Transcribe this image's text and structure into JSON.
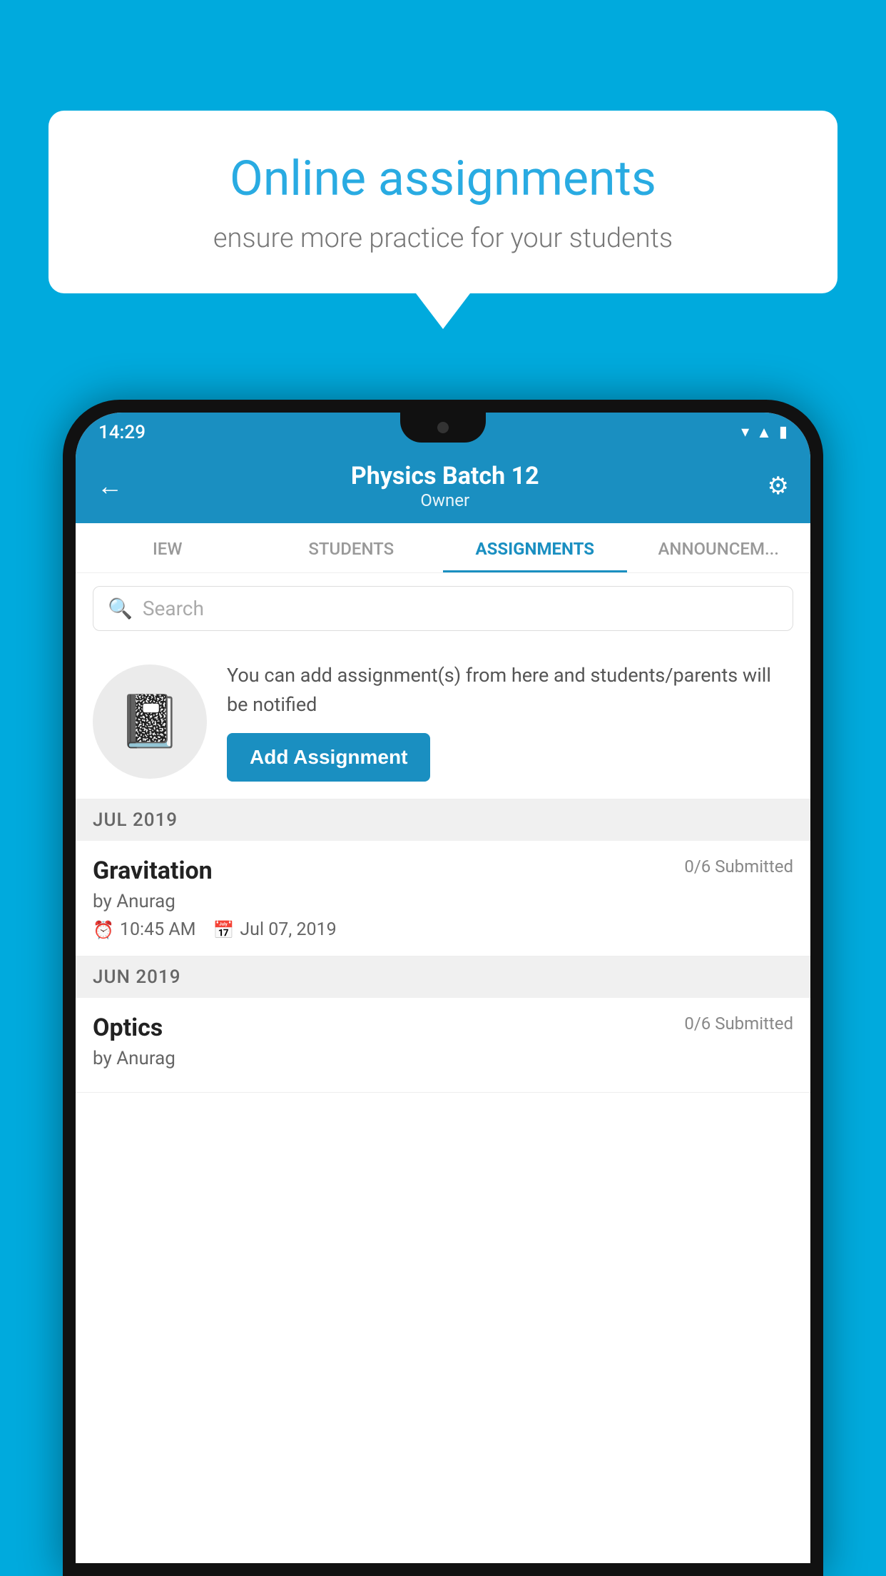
{
  "background_color": "#00AADD",
  "speech_bubble": {
    "title": "Online assignments",
    "subtitle": "ensure more practice for your students"
  },
  "status_bar": {
    "time": "14:29",
    "icons": [
      "wifi",
      "signal",
      "battery"
    ]
  },
  "header": {
    "title": "Physics Batch 12",
    "subtitle": "Owner",
    "back_label": "←",
    "gear_label": "⚙"
  },
  "tabs": [
    {
      "label": "IEW",
      "active": false
    },
    {
      "label": "STUDENTS",
      "active": false
    },
    {
      "label": "ASSIGNMENTS",
      "active": true
    },
    {
      "label": "ANNOUNCEM...",
      "active": false
    }
  ],
  "search": {
    "placeholder": "Search"
  },
  "info_panel": {
    "description": "You can add assignment(s) from here and students/parents will be notified",
    "button_label": "Add Assignment"
  },
  "sections": [
    {
      "header": "JUL 2019",
      "assignments": [
        {
          "name": "Gravitation",
          "submitted": "0/6 Submitted",
          "author": "by Anurag",
          "time": "10:45 AM",
          "date": "Jul 07, 2019"
        }
      ]
    },
    {
      "header": "JUN 2019",
      "assignments": [
        {
          "name": "Optics",
          "submitted": "0/6 Submitted",
          "author": "by Anurag",
          "time": "",
          "date": ""
        }
      ]
    }
  ]
}
